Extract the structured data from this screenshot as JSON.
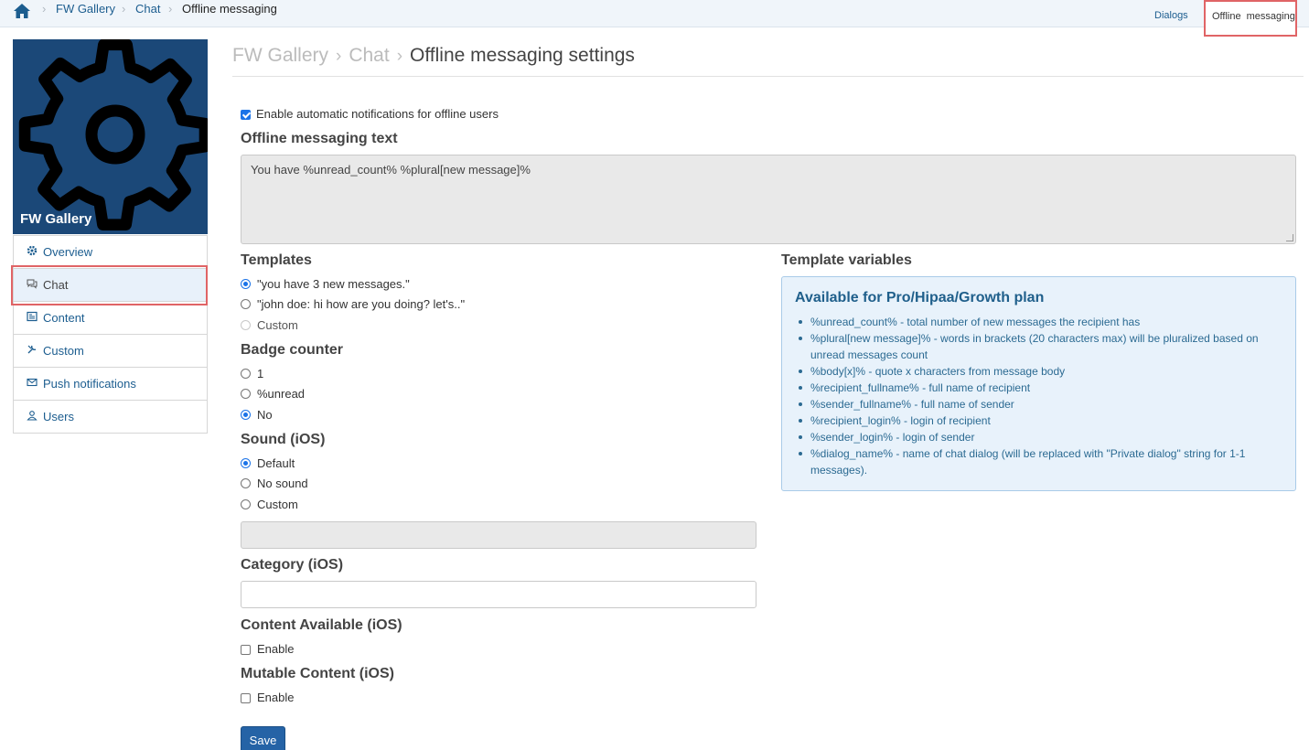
{
  "breadcrumb": {
    "items": [
      "FW Gallery",
      "Chat"
    ],
    "current": "Offline messaging"
  },
  "top_tabs": {
    "dialogs": "Dialogs",
    "offline": "Offline messaging"
  },
  "app": {
    "name": "FW Gallery"
  },
  "sidebar": {
    "items": [
      {
        "label": "Overview",
        "icon": "gear-icon"
      },
      {
        "label": "Chat",
        "icon": "chat-icon"
      },
      {
        "label": "Content",
        "icon": "content-icon"
      },
      {
        "label": "Custom",
        "icon": "wrench-icon"
      },
      {
        "label": "Push  notifications",
        "icon": "mail-icon"
      },
      {
        "label": "Users",
        "icon": "user-icon"
      }
    ]
  },
  "page_title": {
    "crumb1": "FW Gallery",
    "crumb2": "Chat",
    "current": "Offline messaging settings"
  },
  "enable_notifications": {
    "label": "Enable automatic notifications for offline users",
    "checked": true
  },
  "offline_text": {
    "heading": "Offline messaging text",
    "value": "You have %unread_count% %plural[new message]%"
  },
  "templates": {
    "heading": "Templates",
    "options": [
      "\"you have 3 new messages.\"",
      "\"john doe: hi how are you doing? let's..\"",
      "Custom"
    ]
  },
  "badge_counter": {
    "heading": "Badge counter",
    "options": [
      "1",
      "%unread",
      "No"
    ]
  },
  "sound": {
    "heading": "Sound (iOS)",
    "options": [
      "Default",
      "No sound",
      "Custom"
    ]
  },
  "category": {
    "heading": "Category (iOS)"
  },
  "content_available": {
    "heading": "Content Available (iOS)",
    "label": "Enable"
  },
  "mutable_content": {
    "heading": "Mutable Content (iOS)",
    "label": "Enable"
  },
  "template_vars": {
    "heading": "Template variables",
    "box_title": "Available for Pro/Hipaa/Growth plan",
    "items": [
      "%unread_count% - total number of new messages the recipient has",
      "%plural[new message]% - words in brackets (20 characters max) will be pluralized based on unread messages count",
      "%body[x]% - quote x characters from message body",
      "%recipient_fullname% - full name of recipient",
      "%sender_fullname% - full name of sender",
      "%recipient_login% - login of recipient",
      "%sender_login% - login of sender",
      "%dialog_name% - name of chat dialog (will be replaced with \"Private dialog\" string for 1-1 messages)."
    ]
  },
  "save_label": "Save",
  "colors": {
    "accent": "#1c5d8f",
    "highlight": "#e06466",
    "app_bg": "#1b4878"
  }
}
